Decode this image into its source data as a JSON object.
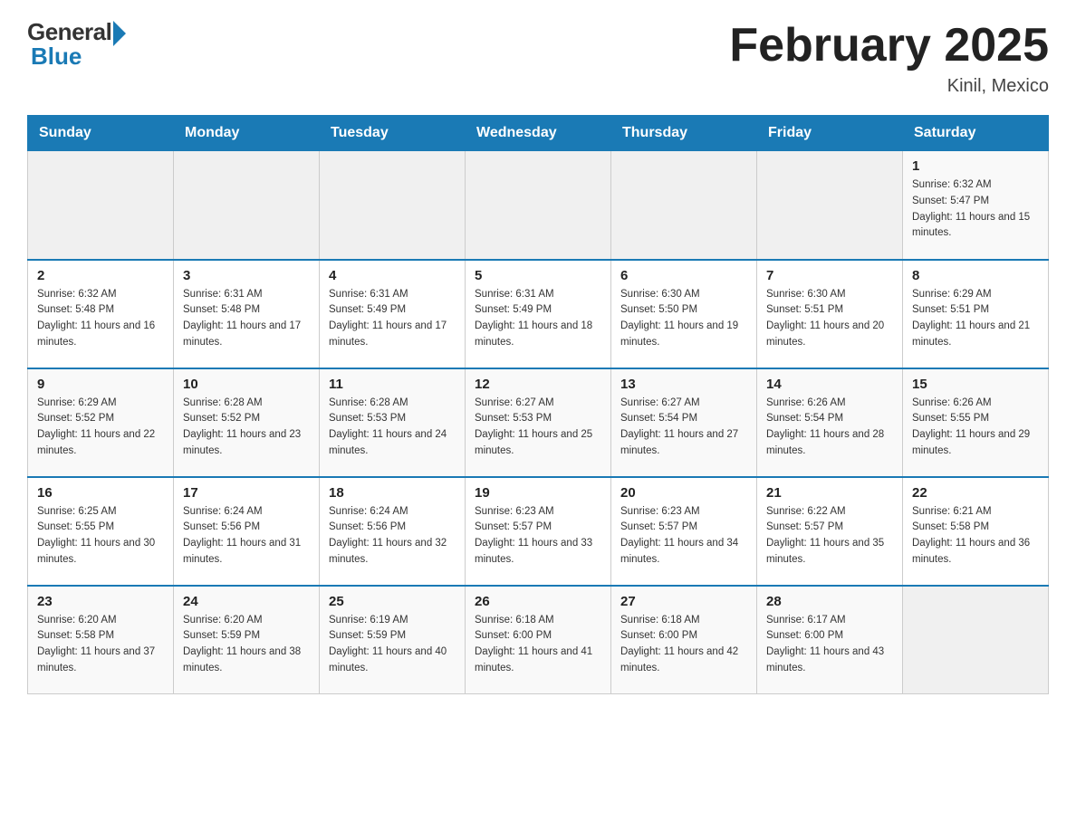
{
  "header": {
    "logo_general": "General",
    "logo_blue": "Blue",
    "calendar_title": "February 2025",
    "calendar_subtitle": "Kinil, Mexico"
  },
  "days_of_week": [
    "Sunday",
    "Monday",
    "Tuesday",
    "Wednesday",
    "Thursday",
    "Friday",
    "Saturday"
  ],
  "weeks": [
    [
      {
        "day": "",
        "info": ""
      },
      {
        "day": "",
        "info": ""
      },
      {
        "day": "",
        "info": ""
      },
      {
        "day": "",
        "info": ""
      },
      {
        "day": "",
        "info": ""
      },
      {
        "day": "",
        "info": ""
      },
      {
        "day": "1",
        "info": "Sunrise: 6:32 AM\nSunset: 5:47 PM\nDaylight: 11 hours and 15 minutes."
      }
    ],
    [
      {
        "day": "2",
        "info": "Sunrise: 6:32 AM\nSunset: 5:48 PM\nDaylight: 11 hours and 16 minutes."
      },
      {
        "day": "3",
        "info": "Sunrise: 6:31 AM\nSunset: 5:48 PM\nDaylight: 11 hours and 17 minutes."
      },
      {
        "day": "4",
        "info": "Sunrise: 6:31 AM\nSunset: 5:49 PM\nDaylight: 11 hours and 17 minutes."
      },
      {
        "day": "5",
        "info": "Sunrise: 6:31 AM\nSunset: 5:49 PM\nDaylight: 11 hours and 18 minutes."
      },
      {
        "day": "6",
        "info": "Sunrise: 6:30 AM\nSunset: 5:50 PM\nDaylight: 11 hours and 19 minutes."
      },
      {
        "day": "7",
        "info": "Sunrise: 6:30 AM\nSunset: 5:51 PM\nDaylight: 11 hours and 20 minutes."
      },
      {
        "day": "8",
        "info": "Sunrise: 6:29 AM\nSunset: 5:51 PM\nDaylight: 11 hours and 21 minutes."
      }
    ],
    [
      {
        "day": "9",
        "info": "Sunrise: 6:29 AM\nSunset: 5:52 PM\nDaylight: 11 hours and 22 minutes."
      },
      {
        "day": "10",
        "info": "Sunrise: 6:28 AM\nSunset: 5:52 PM\nDaylight: 11 hours and 23 minutes."
      },
      {
        "day": "11",
        "info": "Sunrise: 6:28 AM\nSunset: 5:53 PM\nDaylight: 11 hours and 24 minutes."
      },
      {
        "day": "12",
        "info": "Sunrise: 6:27 AM\nSunset: 5:53 PM\nDaylight: 11 hours and 25 minutes."
      },
      {
        "day": "13",
        "info": "Sunrise: 6:27 AM\nSunset: 5:54 PM\nDaylight: 11 hours and 27 minutes."
      },
      {
        "day": "14",
        "info": "Sunrise: 6:26 AM\nSunset: 5:54 PM\nDaylight: 11 hours and 28 minutes."
      },
      {
        "day": "15",
        "info": "Sunrise: 6:26 AM\nSunset: 5:55 PM\nDaylight: 11 hours and 29 minutes."
      }
    ],
    [
      {
        "day": "16",
        "info": "Sunrise: 6:25 AM\nSunset: 5:55 PM\nDaylight: 11 hours and 30 minutes."
      },
      {
        "day": "17",
        "info": "Sunrise: 6:24 AM\nSunset: 5:56 PM\nDaylight: 11 hours and 31 minutes."
      },
      {
        "day": "18",
        "info": "Sunrise: 6:24 AM\nSunset: 5:56 PM\nDaylight: 11 hours and 32 minutes."
      },
      {
        "day": "19",
        "info": "Sunrise: 6:23 AM\nSunset: 5:57 PM\nDaylight: 11 hours and 33 minutes."
      },
      {
        "day": "20",
        "info": "Sunrise: 6:23 AM\nSunset: 5:57 PM\nDaylight: 11 hours and 34 minutes."
      },
      {
        "day": "21",
        "info": "Sunrise: 6:22 AM\nSunset: 5:57 PM\nDaylight: 11 hours and 35 minutes."
      },
      {
        "day": "22",
        "info": "Sunrise: 6:21 AM\nSunset: 5:58 PM\nDaylight: 11 hours and 36 minutes."
      }
    ],
    [
      {
        "day": "23",
        "info": "Sunrise: 6:20 AM\nSunset: 5:58 PM\nDaylight: 11 hours and 37 minutes."
      },
      {
        "day": "24",
        "info": "Sunrise: 6:20 AM\nSunset: 5:59 PM\nDaylight: 11 hours and 38 minutes."
      },
      {
        "day": "25",
        "info": "Sunrise: 6:19 AM\nSunset: 5:59 PM\nDaylight: 11 hours and 40 minutes."
      },
      {
        "day": "26",
        "info": "Sunrise: 6:18 AM\nSunset: 6:00 PM\nDaylight: 11 hours and 41 minutes."
      },
      {
        "day": "27",
        "info": "Sunrise: 6:18 AM\nSunset: 6:00 PM\nDaylight: 11 hours and 42 minutes."
      },
      {
        "day": "28",
        "info": "Sunrise: 6:17 AM\nSunset: 6:00 PM\nDaylight: 11 hours and 43 minutes."
      },
      {
        "day": "",
        "info": ""
      }
    ]
  ]
}
